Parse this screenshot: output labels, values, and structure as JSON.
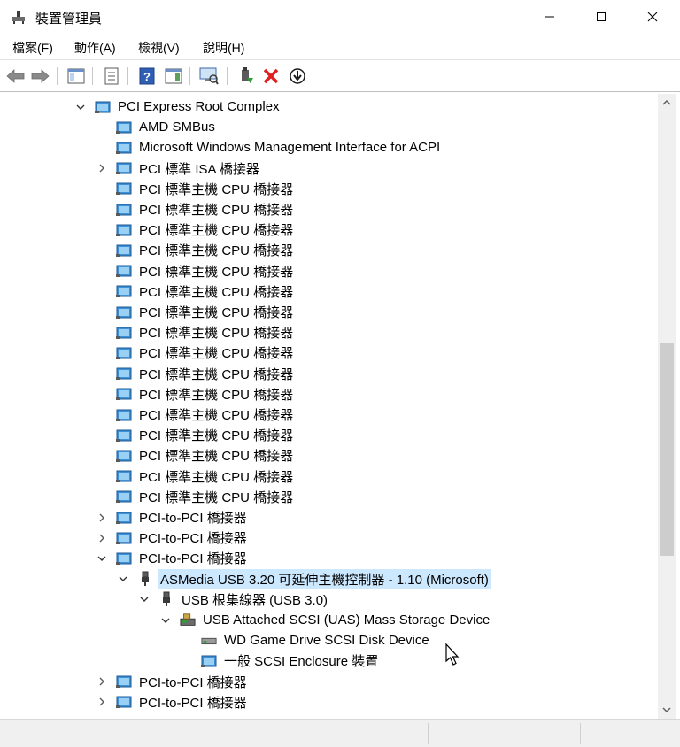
{
  "window": {
    "title": "裝置管理員",
    "minimize_label": "minimize",
    "maximize_label": "maximize",
    "close_label": "close"
  },
  "menu": {
    "items": [
      "檔案(F)",
      "動作(A)",
      "檢視(V)",
      "說明(H)"
    ]
  },
  "toolbar": {
    "buttons": [
      {
        "icon": "back-arrow-icon"
      },
      {
        "icon": "forward-arrow-icon"
      },
      {
        "icon": "show-hide-console-tree-icon"
      },
      {
        "icon": "properties-icon"
      },
      {
        "icon": "help-icon"
      },
      {
        "icon": "action-pane-icon"
      },
      {
        "icon": "scan-hardware-icon"
      },
      {
        "icon": "update-driver-icon"
      },
      {
        "icon": "uninstall-device-icon"
      },
      {
        "icon": "disable-device-icon"
      }
    ],
    "accent_green": "#2e9c3a",
    "accent_red": "#e02020"
  },
  "tree": {
    "rows": [
      {
        "label": "PCI Express Root Complex",
        "indent": 0,
        "expander": "expanded",
        "icon": "device-icon"
      },
      {
        "label": "AMD SMBus",
        "indent": 1,
        "expander": "none",
        "icon": "device-icon"
      },
      {
        "label": "Microsoft Windows Management Interface for ACPI",
        "indent": 1,
        "expander": "none",
        "icon": "device-icon"
      },
      {
        "label": "PCI 標準 ISA 橋接器",
        "indent": 1,
        "expander": "collapsed",
        "icon": "device-icon"
      },
      {
        "label": "PCI 標準主機 CPU 橋接器",
        "indent": 1,
        "expander": "none",
        "icon": "device-icon"
      },
      {
        "label": "PCI 標準主機 CPU 橋接器",
        "indent": 1,
        "expander": "none",
        "icon": "device-icon"
      },
      {
        "label": "PCI 標準主機 CPU 橋接器",
        "indent": 1,
        "expander": "none",
        "icon": "device-icon"
      },
      {
        "label": "PCI 標準主機 CPU 橋接器",
        "indent": 1,
        "expander": "none",
        "icon": "device-icon"
      },
      {
        "label": "PCI 標準主機 CPU 橋接器",
        "indent": 1,
        "expander": "none",
        "icon": "device-icon"
      },
      {
        "label": "PCI 標準主機 CPU 橋接器",
        "indent": 1,
        "expander": "none",
        "icon": "device-icon"
      },
      {
        "label": "PCI 標準主機 CPU 橋接器",
        "indent": 1,
        "expander": "none",
        "icon": "device-icon"
      },
      {
        "label": "PCI 標準主機 CPU 橋接器",
        "indent": 1,
        "expander": "none",
        "icon": "device-icon"
      },
      {
        "label": "PCI 標準主機 CPU 橋接器",
        "indent": 1,
        "expander": "none",
        "icon": "device-icon"
      },
      {
        "label": "PCI 標準主機 CPU 橋接器",
        "indent": 1,
        "expander": "none",
        "icon": "device-icon"
      },
      {
        "label": "PCI 標準主機 CPU 橋接器",
        "indent": 1,
        "expander": "none",
        "icon": "device-icon"
      },
      {
        "label": "PCI 標準主機 CPU 橋接器",
        "indent": 1,
        "expander": "none",
        "icon": "device-icon"
      },
      {
        "label": "PCI 標準主機 CPU 橋接器",
        "indent": 1,
        "expander": "none",
        "icon": "device-icon"
      },
      {
        "label": "PCI 標準主機 CPU 橋接器",
        "indent": 1,
        "expander": "none",
        "icon": "device-icon"
      },
      {
        "label": "PCI 標準主機 CPU 橋接器",
        "indent": 1,
        "expander": "none",
        "icon": "device-icon"
      },
      {
        "label": "PCI 標準主機 CPU 橋接器",
        "indent": 1,
        "expander": "none",
        "icon": "device-icon"
      },
      {
        "label": "PCI-to-PCI 橋接器",
        "indent": 1,
        "expander": "collapsed",
        "icon": "device-icon"
      },
      {
        "label": "PCI-to-PCI 橋接器",
        "indent": 1,
        "expander": "collapsed",
        "icon": "device-icon"
      },
      {
        "label": "PCI-to-PCI 橋接器",
        "indent": 1,
        "expander": "expanded",
        "icon": "device-icon"
      },
      {
        "label": "ASMedia USB 3.20 可延伸主機控制器 - 1.10 (Microsoft)",
        "indent": 2,
        "expander": "expanded",
        "icon": "usb-plug-icon",
        "selected": true
      },
      {
        "label": "USB 根集線器 (USB 3.0)",
        "indent": 3,
        "expander": "expanded",
        "icon": "usb-plug-icon"
      },
      {
        "label": "USB Attached SCSI (UAS) Mass Storage Device",
        "indent": 4,
        "expander": "expanded",
        "icon": "storage-controller-icon"
      },
      {
        "label": "WD Game Drive SCSI Disk Device",
        "indent": 5,
        "expander": "none",
        "icon": "disk-drive-icon"
      },
      {
        "label": "一般 SCSI Enclosure 裝置",
        "indent": 5,
        "expander": "none",
        "icon": "device-icon"
      },
      {
        "label": "PCI-to-PCI 橋接器",
        "indent": 1,
        "expander": "collapsed",
        "icon": "device-icon"
      },
      {
        "label": "PCI-to-PCI 橋接器",
        "indent": 1,
        "expander": "collapsed",
        "icon": "device-icon"
      }
    ],
    "selection_color": "#cce8ff"
  }
}
